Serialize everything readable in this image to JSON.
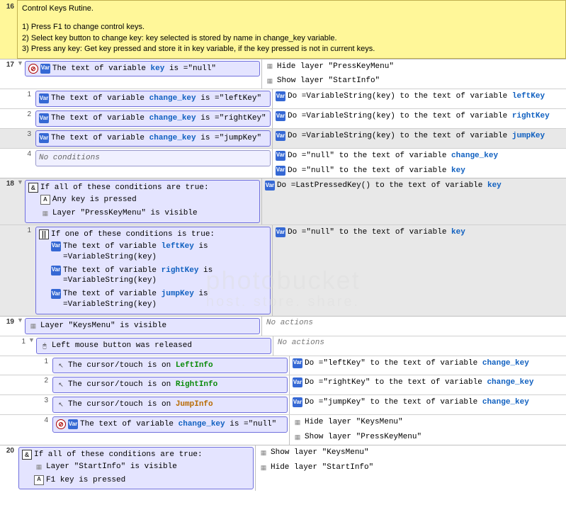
{
  "header": {
    "num": "16",
    "title": "Control Keys Rutine.",
    "lines": [
      "1) Press F1 to change control keys.",
      "2) Select key button to change key: key selected is stored by name in change_key variable.",
      "3) Press any key: Get key pressed and store it in key variable, if the key pressed is not in current keys."
    ]
  },
  "watermark1": "photobucket",
  "watermark2": "host. store. share.",
  "ev17": {
    "num": "17",
    "c_pre": "The text of variable ",
    "c_var": "key",
    "c_post": " is =\"null\"",
    "a1_pre": "Hide layer ",
    "a1_q": "\"PressKeyMenu\"",
    "a2_pre": "Show layer ",
    "a2_q": "\"StartInfo\""
  },
  "ev17_1": {
    "n": "1",
    "c_pre": "The text of variable ",
    "c_var": "change_key",
    "c_post": " is =\"leftKey\"",
    "a_pre": "Do =VariableString(key) to the text of variable ",
    "a_var": "leftKey"
  },
  "ev17_2": {
    "n": "2",
    "c_pre": "The text of variable ",
    "c_var": "change_key",
    "c_post": " is =\"rightKey\"",
    "a_pre": "Do =VariableString(key) to the text of variable ",
    "a_var": "rightKey"
  },
  "ev17_3": {
    "n": "3",
    "c_pre": "The text of variable ",
    "c_var": "change_key",
    "c_post": " is =\"jumpKey\"",
    "a_pre": "Do =VariableString(key) to the text of variable ",
    "a_var": "jumpKey"
  },
  "ev17_4": {
    "n": "4",
    "c": "No conditions",
    "a1_pre": "Do =\"null\" to the text of variable ",
    "a1_var": "change_key",
    "a2_pre": "Do =\"null\" to the text of variable ",
    "a2_var": "key"
  },
  "ev18": {
    "num": "18",
    "c_title": "If all of these conditions are true:",
    "c1": "Any key is pressed",
    "c2": "Layer \"PressKeyMenu\" is visible",
    "a_pre": "Do =LastPressedKey() to the text of variable ",
    "a_var": "key"
  },
  "ev18_1": {
    "n": "1",
    "c_title": "If one of these conditions is true:",
    "c1_pre": "The text of variable ",
    "c1_var": "leftKey",
    "c1_post": " is =VariableString(key)",
    "c2_pre": "The text of variable ",
    "c2_var": "rightKey",
    "c2_post": " is =VariableString(key)",
    "c3_pre": "The text of variable ",
    "c3_var": "jumpKey",
    "c3_post": " is =VariableString(key)",
    "a_pre": "Do =\"null\" to the text of variable ",
    "a_var": "key"
  },
  "ev19": {
    "num": "19",
    "c": "Layer \"KeysMenu\" is visible",
    "noact": "No actions"
  },
  "ev19_1": {
    "n": "1",
    "c": "Left mouse button was released",
    "noact": "No actions"
  },
  "ev19_1_1": {
    "n": "1",
    "c_pre": "The cursor/touch is on ",
    "c_obj": "LeftInfo",
    "a_pre": "Do =\"leftKey\" to the text of variable ",
    "a_var": "change_key"
  },
  "ev19_1_2": {
    "n": "2",
    "c_pre": "The cursor/touch is on ",
    "c_obj": "RightInfo",
    "a_pre": "Do =\"rightKey\" to the text of variable ",
    "a_var": "change_key"
  },
  "ev19_1_3": {
    "n": "3",
    "c_pre": "The cursor/touch is on ",
    "c_obj": "JumpInfo",
    "a_pre": "Do =\"jumpKey\" to the text of variable ",
    "a_var": "change_key"
  },
  "ev19_1_4": {
    "n": "4",
    "c_pre": "The text of variable ",
    "c_var": "change_key",
    "c_post": " is =\"null\"",
    "a1_pre": "Hide layer ",
    "a1_q": "\"KeysMenu\"",
    "a2_pre": "Show layer ",
    "a2_q": "\"PressKeyMenu\""
  },
  "ev20": {
    "num": "20",
    "c_title": "If all of these conditions are true:",
    "c1": "Layer \"StartInfo\" is visible",
    "c2": "F1 key is pressed",
    "a1_pre": "Show layer ",
    "a1_q": "\"KeysMenu\"",
    "a2_pre": "Hide layer ",
    "a2_q": "\"StartInfo\""
  }
}
